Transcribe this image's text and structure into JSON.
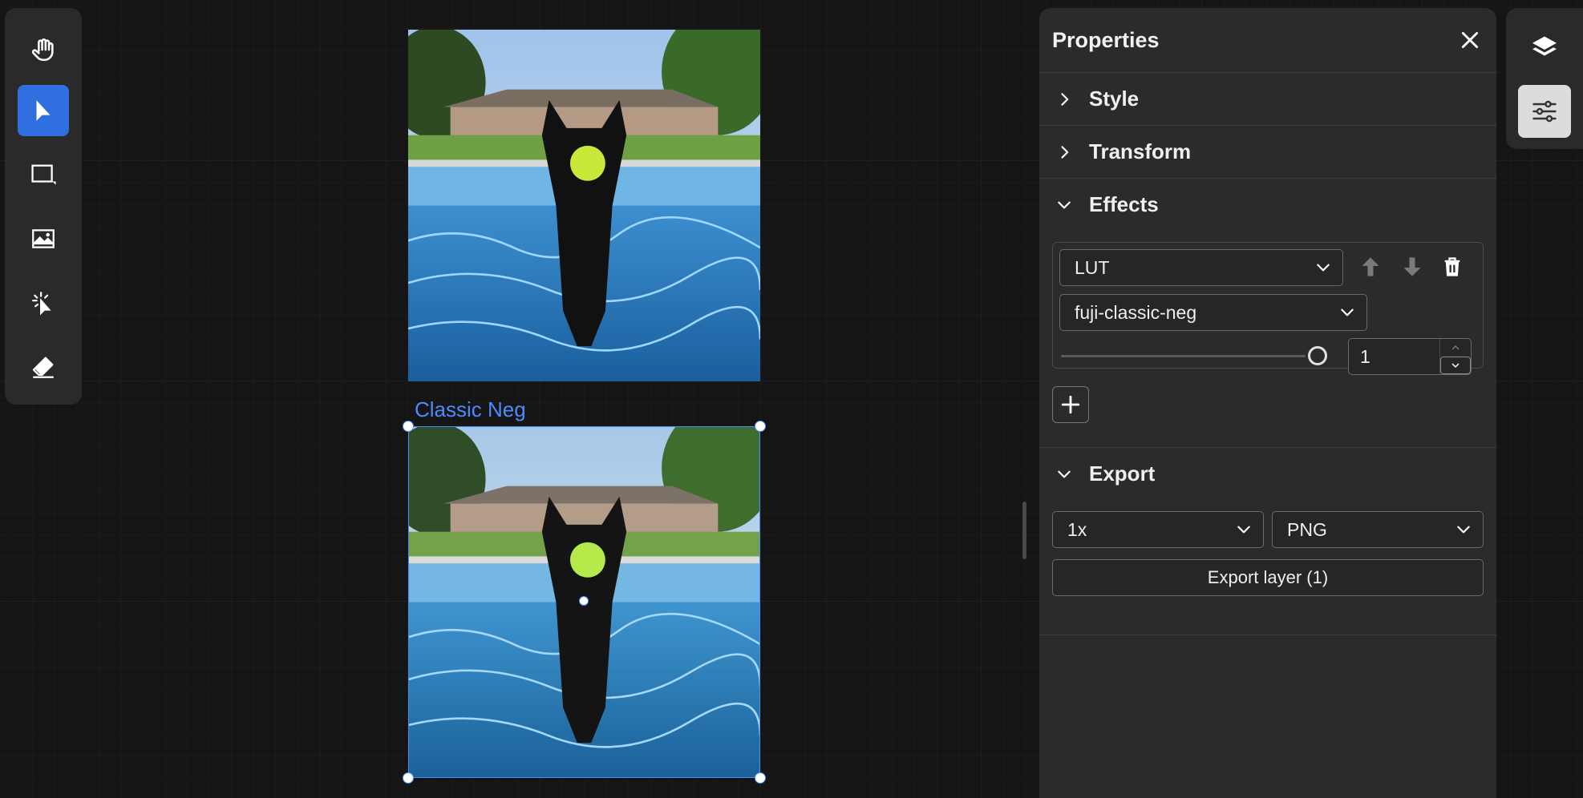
{
  "toolbar": {
    "tools": [
      {
        "name": "hand-icon",
        "active": false
      },
      {
        "name": "select-arrow-icon",
        "active": true
      },
      {
        "name": "rectangle-icon",
        "active": false
      },
      {
        "name": "image-icon",
        "active": false
      },
      {
        "name": "magic-select-icon",
        "active": false
      },
      {
        "name": "eraser-icon",
        "active": false
      }
    ]
  },
  "canvas": {
    "selected_layer_label": "Classic Neg"
  },
  "properties": {
    "title": "Properties",
    "sections": {
      "style": "Style",
      "transform": "Transform",
      "effects": "Effects",
      "export": "Export"
    },
    "effect": {
      "type": "LUT",
      "preset": "fuji-classic-neg",
      "intensity_value": "1",
      "slider_level": 1.0
    },
    "export": {
      "scale": "1x",
      "format": "PNG",
      "button_label": "Export layer (1)"
    }
  },
  "right_panel": {
    "buttons": [
      {
        "name": "layers-icon",
        "active": false
      },
      {
        "name": "sliders-icon",
        "active": true
      }
    ]
  },
  "colors": {
    "accent": "#2f6fe0",
    "selection": "#4a8cff",
    "panel_bg": "#2b2b2b",
    "canvas_bg": "#151515"
  }
}
